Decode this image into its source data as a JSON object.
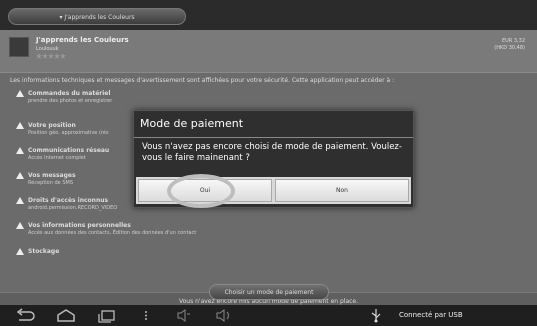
{
  "header": {
    "store_title": "▾ J'apprends les Couleurs"
  },
  "app": {
    "name": "J'apprends les Couleurs",
    "developer": "Loulouuk",
    "price_line1": "EUR 3,32",
    "price_line2": "(HKD 30,48)"
  },
  "permissions": {
    "intro": "Les informations techniques et messages d'avertissement sont affichées pour votre sécurité. Cette application peut accéder à :",
    "items": [
      {
        "title": "Commandes du matériel",
        "detail": "prendre des photos et enregistrer"
      },
      {
        "title": "Votre position",
        "detail": "Position géo. approximative (rés"
      },
      {
        "title": "Communications réseau",
        "detail": "Accès Internet complet"
      },
      {
        "title": "Vos messages",
        "detail": "Réception de SMS"
      },
      {
        "title": "Droits d'accès inconnus",
        "detail": "android.permission.RECORD_VIDEO"
      },
      {
        "title": "Vos informations personnelles",
        "detail": "Accès aux données des contacts, Édition des données d'un contact"
      },
      {
        "title": "Stockage",
        "detail": ""
      }
    ]
  },
  "footer": {
    "notice": "Vous n'avez encore mis aucun mode de paiement en place.",
    "choose_button": "Choisir un mode de paiement"
  },
  "dialog": {
    "title": "Mode de paiement",
    "message": "Vous n'avez pas encore choisi de mode de paiement. Voulez-vous le faire mainenant ?",
    "yes": "Oui",
    "no": "Non"
  },
  "status": {
    "connection": "Connecté par USB"
  },
  "icons": {
    "nav": [
      "back-icon",
      "home-icon",
      "recent-apps-icon",
      "menu-icon",
      "volume-down-icon",
      "volume-up-icon",
      "usb-icon"
    ]
  }
}
